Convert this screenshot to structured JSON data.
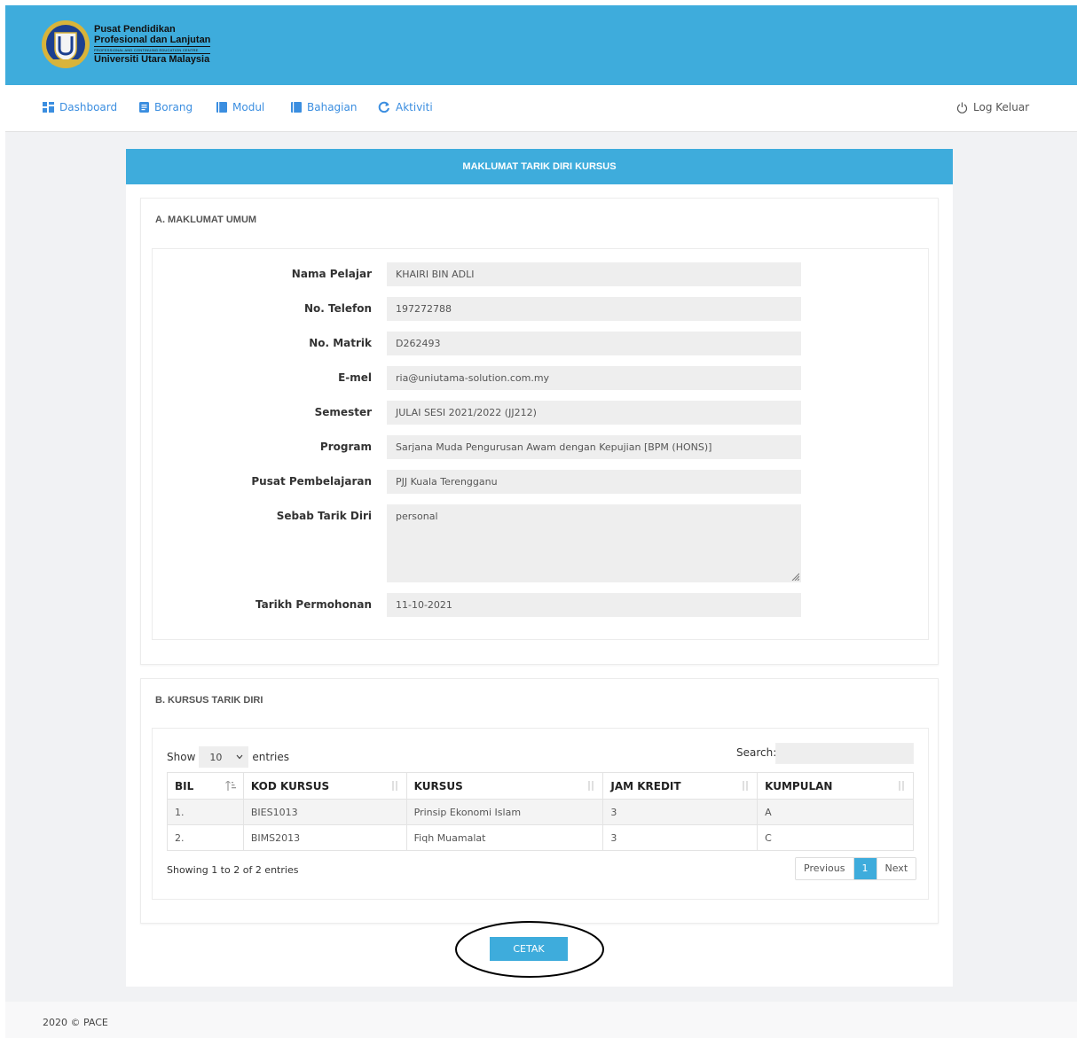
{
  "header": {
    "logo_line1": "Pusat Pendidikan",
    "logo_line2": "Profesional dan Lanjutan",
    "logo_line3": "PROFESSIONAL AND CONTINUING EDUCATION CENTRE",
    "logo_line4": "Universiti Utara Malaysia"
  },
  "nav": {
    "dashboard": "Dashboard",
    "borang": "Borang",
    "modul": "Modul",
    "bahagian": "Bahagian",
    "aktiviti": "Aktiviti",
    "logout": "Log Keluar"
  },
  "main": {
    "title": "MAKLUMAT TARIK DIRI KURSUS"
  },
  "section_a": {
    "title": "A. MAKLUMAT UMUM",
    "fields": [
      {
        "label": "Nama Pelajar",
        "value": "KHAIRI BIN ADLI"
      },
      {
        "label": "No. Telefon",
        "value": "197272788"
      },
      {
        "label": "No. Matrik",
        "value": "D262493"
      },
      {
        "label": "E-mel",
        "value": "ria@uniutama-solution.com.my"
      },
      {
        "label": "Semester",
        "value": "JULAI SESI 2021/2022 (JJ212)"
      },
      {
        "label": "Program",
        "value": "Sarjana Muda Pengurusan Awam dengan Kepujian [BPM (HONS)]"
      },
      {
        "label": "Pusat Pembelajaran",
        "value": "PJJ Kuala Terengganu"
      },
      {
        "label": "Sebab Tarik Diri",
        "value": "personal"
      },
      {
        "label": "Tarikh Permohonan",
        "value": "11-10-2021"
      }
    ]
  },
  "section_b": {
    "title": "B. KURSUS TARIK DIRI",
    "show_label": "Show",
    "entries_value": "10",
    "entries_label": "entries",
    "search_label": "Search:",
    "columns": [
      "BIL",
      "KOD KURSUS",
      "KURSUS",
      "JAM KREDIT",
      "KUMPULAN"
    ],
    "rows": [
      [
        "1.",
        "BIES1013",
        "Prinsip Ekonomi Islam",
        "3",
        "A"
      ],
      [
        "2.",
        "BIMS2013",
        "Fiqh Muamalat",
        "3",
        "C"
      ]
    ],
    "info": "Showing 1 to 2 of 2 entries",
    "pager": {
      "previous": "Previous",
      "page": "1",
      "next": "Next"
    }
  },
  "actions": {
    "print": "CETAK"
  },
  "footer": {
    "text": "2020 © PACE"
  },
  "colors": {
    "accent": "#3eacdc",
    "link": "#3b8ee0"
  }
}
